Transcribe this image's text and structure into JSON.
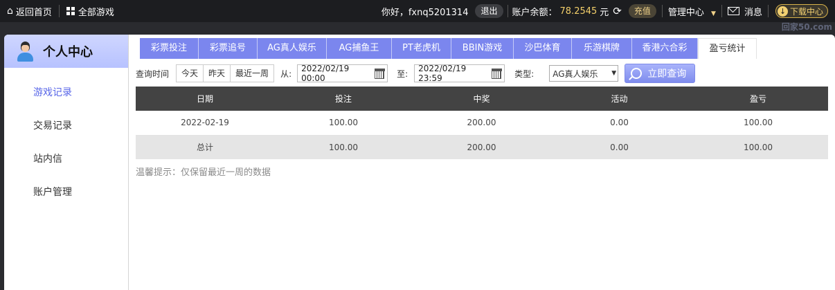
{
  "topbar": {
    "home": "返回首页",
    "all_games": "全部游戏",
    "greeting": "你好，fxnq5201314",
    "logout": "退出",
    "balance_label": "账户余额：",
    "balance_value": "78.2545",
    "balance_unit": "元",
    "recharge": "充值",
    "manage": "管理中心",
    "messages": "消息",
    "download": "下载中心"
  },
  "sidebar": {
    "title": "个人中心",
    "items": [
      {
        "label": "游戏记录"
      },
      {
        "label": "交易记录"
      },
      {
        "label": "站内信"
      },
      {
        "label": "账户管理"
      }
    ]
  },
  "tabs": [
    {
      "label": "彩票投注"
    },
    {
      "label": "彩票追号"
    },
    {
      "label": "AG真人娱乐"
    },
    {
      "label": "AG捕鱼王"
    },
    {
      "label": "PT老虎机"
    },
    {
      "label": "BBIN游戏"
    },
    {
      "label": "沙巴体育"
    },
    {
      "label": "乐游棋牌"
    },
    {
      "label": "香港六合彩"
    },
    {
      "label": "盈亏统计"
    }
  ],
  "filter": {
    "label": "查询时间",
    "quick": [
      "今天",
      "昨天",
      "最近一周"
    ],
    "from_label": "从:",
    "from_value": "2022/02/19 00:00",
    "to_label": "至:",
    "to_value": "2022/02/19 23:59",
    "type_label": "类型:",
    "type_value": "AG真人娱乐",
    "query": "立即查询"
  },
  "table": {
    "headers": [
      "日期",
      "投注",
      "中奖",
      "活动",
      "盈亏"
    ],
    "rows": [
      [
        "2022-02-19",
        "100.00",
        "200.00",
        "0.00",
        "100.00"
      ]
    ],
    "total": [
      "总计",
      "100.00",
      "200.00",
      "0.00",
      "100.00"
    ]
  },
  "tip": "温馨提示：仅保留最近一周的数据",
  "watermark": "回家50.com",
  "colors": {
    "tab": "#7b86ee",
    "header": "#434343",
    "accent": "#5866e8",
    "balance": "#f3cf6a"
  }
}
